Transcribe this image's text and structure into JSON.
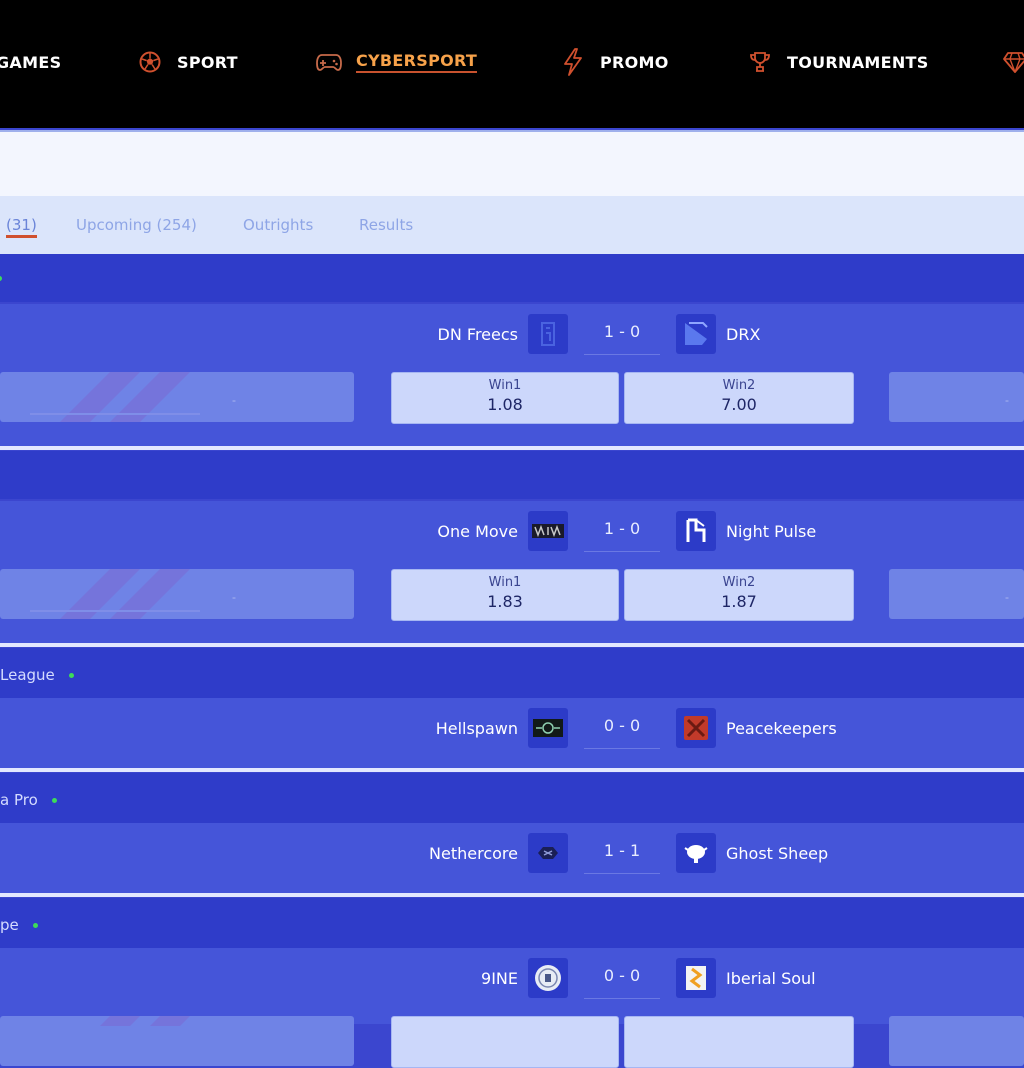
{
  "nav": {
    "items": [
      {
        "label": "GAMES",
        "icon": "none"
      },
      {
        "label": "SPORT",
        "icon": "soccer-ball-icon"
      },
      {
        "label": "CYBERSPORT",
        "icon": "gamepad-icon",
        "active": true
      },
      {
        "label": "PROMO",
        "icon": "lightning-icon"
      },
      {
        "label": "TOURNAMENTS",
        "icon": "trophy-icon"
      }
    ]
  },
  "tabs": [
    {
      "label": "(31)",
      "active": true
    },
    {
      "label": "Upcoming (254)"
    },
    {
      "label": "Outrights"
    },
    {
      "label": "Results"
    }
  ],
  "leagues": [
    {
      "name": "League"
    },
    {
      "name": "a Pro"
    },
    {
      "name": "pe"
    }
  ],
  "matches": [
    {
      "team1": "DN Freecs",
      "team2": "DRX",
      "score": "1 - 0",
      "odds": [
        {
          "label": "Win1",
          "value": "1.08"
        },
        {
          "label": "Win2",
          "value": "7.00"
        }
      ],
      "placeholder": "-"
    },
    {
      "team1": "One Move",
      "team2": "Night Pulse",
      "score": "1 - 0",
      "odds": [
        {
          "label": "Win1",
          "value": "1.83"
        },
        {
          "label": "Win2",
          "value": "1.87"
        }
      ],
      "placeholder": "-"
    },
    {
      "team1": "Hellspawn",
      "team2": "Peacekeepers",
      "score": "0 - 0"
    },
    {
      "team1": "Nethercore",
      "team2": "Ghost Sheep",
      "score": "1 - 1"
    },
    {
      "team1": "9INE",
      "team2": "Iberial Soul",
      "score": "0 - 0"
    }
  ],
  "colors": {
    "accent": "#f7a24a",
    "underline": "#d0502e",
    "live": "#3ddc59",
    "panel": "#4555d9"
  }
}
